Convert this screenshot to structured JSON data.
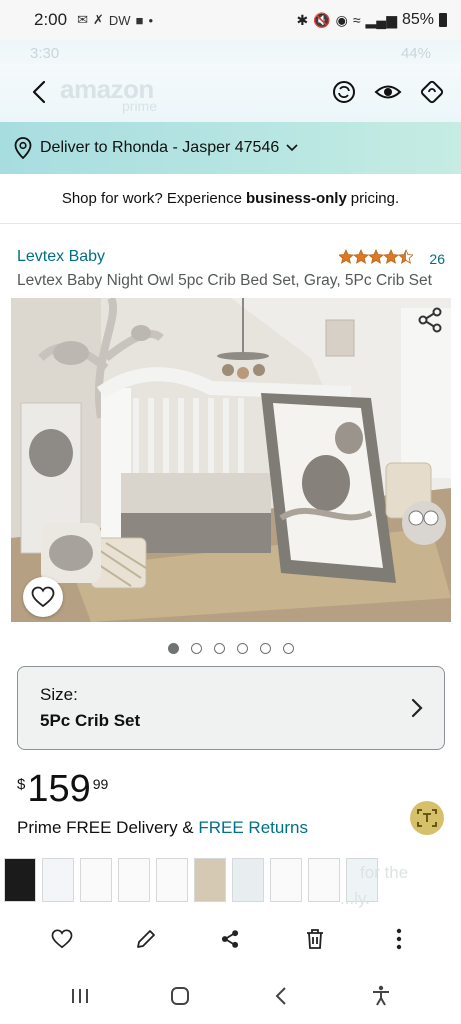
{
  "status_bar": {
    "time": "2:00",
    "notif_text": "DW",
    "battery": "85%"
  },
  "ghost_bar": {
    "left": "3:30",
    "right": "44%"
  },
  "header": {
    "brand": "amazon",
    "brand_sub": "prime"
  },
  "deliver": {
    "text": "Deliver to Rhonda - Jasper 47546"
  },
  "business_banner": {
    "prefix": "Shop for work? Experience",
    "bold": "business-only",
    "suffix": "pricing."
  },
  "product": {
    "brand": "Levtex Baby",
    "rating_stars": 4.5,
    "rating_count": "26",
    "title": "Levtex Baby Night Owl 5pc Crib Bed Set, Gray, 5Pc Crib Set",
    "image_count": 6,
    "active_image": 0
  },
  "size": {
    "label": "Size:",
    "value": "5Pc Crib Set"
  },
  "price": {
    "currency": "$",
    "whole": "159",
    "fraction": "99"
  },
  "delivery": {
    "text": "Prime FREE Delivery &",
    "link": "FREE Returns"
  },
  "recents": {
    "ghost_line_1": "for the",
    "ghost_line_2": "...ly."
  },
  "colors": {
    "link": "#007185",
    "star": "#de7921",
    "deliver_bg": "#b8e6e2"
  }
}
